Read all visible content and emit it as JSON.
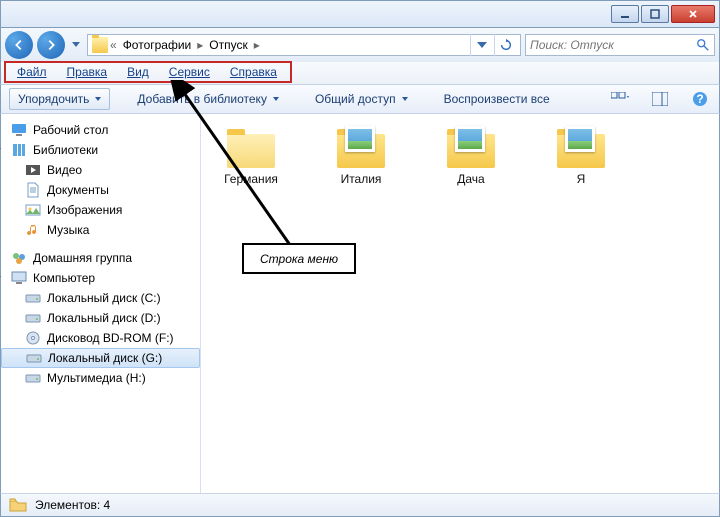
{
  "window": {
    "min_tooltip": "Minimize",
    "max_tooltip": "Maximize",
    "close_tooltip": "Close"
  },
  "breadcrumb": {
    "segments": [
      "Фотографии",
      "Отпуск"
    ]
  },
  "search": {
    "placeholder": "Поиск: Отпуск"
  },
  "menubar": {
    "items": [
      "Файл",
      "Правка",
      "Вид",
      "Сервис",
      "Справка"
    ]
  },
  "toolbar": {
    "organize": "Упорядочить",
    "add_to_library": "Добавить в библиотеку",
    "share": "Общий доступ",
    "play_all": "Воспроизвести все"
  },
  "sidebar": {
    "desktop": "Рабочий стол",
    "libraries": "Библиотеки",
    "lib_items": {
      "video": "Видео",
      "documents": "Документы",
      "images": "Изображения",
      "music": "Музыка"
    },
    "homegroup": "Домашняя группа",
    "computer": "Компьютер",
    "drives": {
      "c": "Локальный диск (C:)",
      "d": "Локальный диск (D:)",
      "f": "Дисковод BD-ROM (F:)",
      "g": "Локальный диск (G:)",
      "h": "Мультимедиа (H:)"
    }
  },
  "content": {
    "items": [
      {
        "name": "Германия",
        "has_photos": false
      },
      {
        "name": "Италия",
        "has_photos": true
      },
      {
        "name": "Дача",
        "has_photos": true
      },
      {
        "name": "Я",
        "has_photos": true
      }
    ]
  },
  "statusbar": {
    "label": "Элементов: 4"
  },
  "annotation": {
    "label": "Строка меню"
  }
}
